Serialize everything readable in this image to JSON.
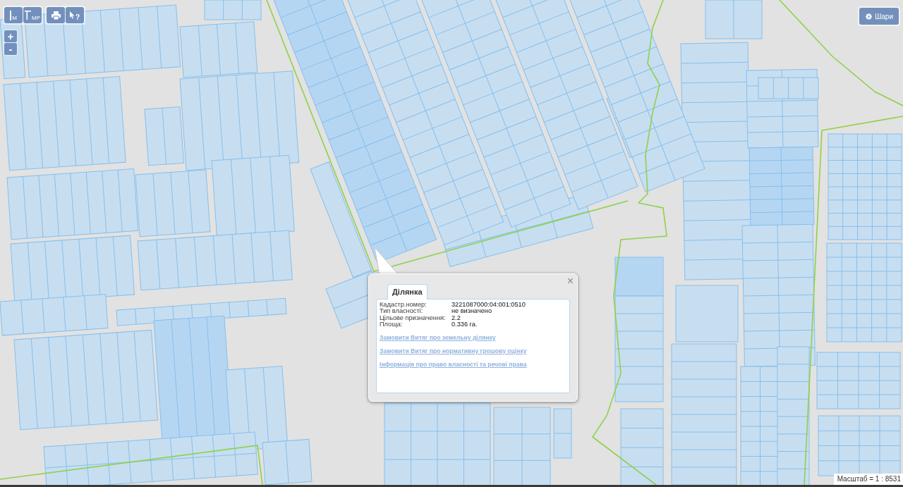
{
  "toolbar": {
    "buttons": [
      {
        "kind": "distance",
        "label": "М"
      },
      {
        "kind": "area",
        "label": "МР"
      },
      {
        "kind": "print"
      },
      {
        "kind": "identify",
        "label": "?"
      }
    ]
  },
  "zoom": {
    "buttons": [
      "+",
      "-"
    ]
  },
  "layers_button": {
    "label": "Шари"
  },
  "popup": {
    "close": "×",
    "tab": {
      "label": "Ділянка",
      "selected": true
    },
    "fields": [
      {
        "label": "Кадастр.номер:",
        "value": "3221087000:04:001:0510"
      },
      {
        "label": "Тип власності:",
        "value": "не визначено"
      },
      {
        "label": "Цільове призначення:",
        "value": "2.2"
      },
      {
        "label": "Площа:",
        "value": "0.336 га."
      }
    ],
    "links": [
      "Замовити Витяг про земельну ділянку",
      "Замовити Витяг про нормативну грошову оцінку",
      "Інформація про право власності та речові права"
    ]
  },
  "scale": "Масштаб = 1 : 8531"
}
